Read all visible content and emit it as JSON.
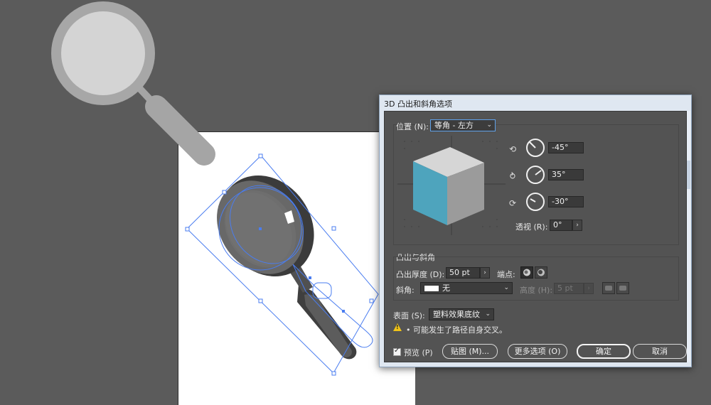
{
  "dialog": {
    "title": "3D 凸出和斜角选项"
  },
  "position": {
    "label": "位置 (N):",
    "selected": "等角 - 左方",
    "rotations": [
      {
        "icon": "x-axis-rotate-icon",
        "value": "-45°",
        "angle": -45
      },
      {
        "icon": "y-axis-rotate-icon",
        "value": "35°",
        "angle": 35
      },
      {
        "icon": "z-axis-rotate-icon",
        "value": "-30°",
        "angle": -30
      }
    ],
    "perspective_label": "透视 (R):",
    "perspective_value": "0°"
  },
  "extrude": {
    "section_title": "凸出与斜角",
    "depth_label": "凸出厚度 (D):",
    "depth_value": "50 pt",
    "cap_label": "端点:",
    "bevel_label": "斜角:",
    "bevel_value": "无",
    "height_label": "高度 (H):",
    "height_value": "5 pt"
  },
  "surface": {
    "label": "表面 (S):",
    "selected": "塑料效果底纹"
  },
  "warning": {
    "text": "• 可能发生了路径自身交叉。"
  },
  "footer": {
    "preview_label": "预览 (P)",
    "preview_checked": true,
    "map_label": "贴图 (M)...",
    "more_label": "更多选项 (O)",
    "ok_label": "确定",
    "cancel_label": "取消"
  },
  "colors": {
    "cube_front": "#4ea4bd",
    "cube_top": "#d6d6d6",
    "cube_side": "#9b9b9b",
    "selection": "#4a7df0",
    "accent_focus": "#5fa1e8"
  }
}
